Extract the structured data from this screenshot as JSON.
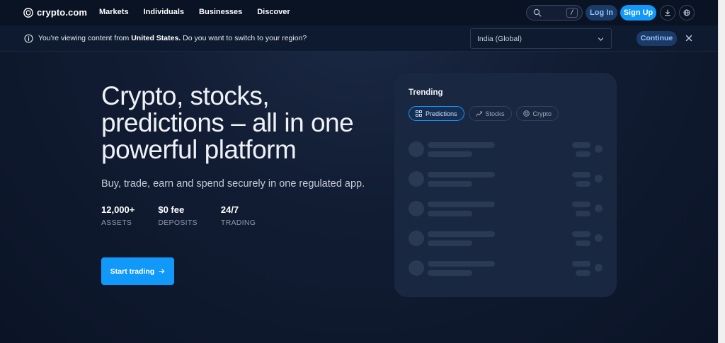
{
  "nav": {
    "logo_text": "crypto.com",
    "links": [
      "Markets",
      "Individuals",
      "Businesses",
      "Discover"
    ],
    "search_shortcut": "/",
    "login_label": "Log In",
    "signup_label": "Sign Up"
  },
  "banner": {
    "text_prefix": "You're viewing content from ",
    "country": "United States.",
    "text_suffix": " Do you want to switch to your region?",
    "region_value": "India (Global)",
    "continue_label": "Continue"
  },
  "hero": {
    "title": "Crypto, stocks, predictions – all in one powerful platform",
    "subtitle": "Buy, trade, earn and spend securely in one regulated app.",
    "stats": [
      {
        "value": "12,000+",
        "label": "ASSETS"
      },
      {
        "value": "$0 fee",
        "label": "DEPOSITS"
      },
      {
        "value": "24/7",
        "label": "TRADING"
      }
    ],
    "cta_label": "Start trading"
  },
  "trending": {
    "title": "Trending",
    "tabs": [
      "Predictions",
      "Stocks",
      "Crypto"
    ],
    "active_tab": "Predictions"
  },
  "colors": {
    "accent": "#1199fa",
    "background": "#0b1426",
    "card": "#1a2740"
  }
}
